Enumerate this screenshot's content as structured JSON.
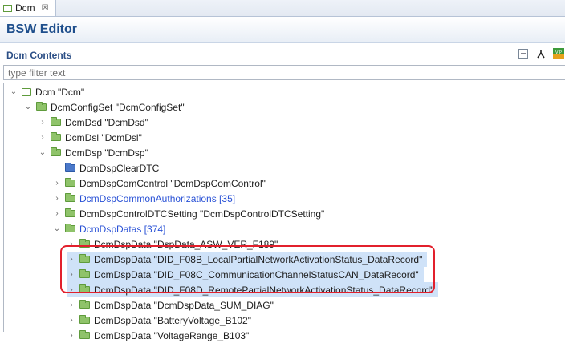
{
  "tab": {
    "label": "Dcm",
    "close": "☒"
  },
  "editor": {
    "title": "BSW Editor"
  },
  "section": {
    "title": "Dcm Contents"
  },
  "filter": {
    "placeholder": "type filter text"
  },
  "tree": [
    {
      "label": "Dcm \"Dcm\"",
      "icon": "module-icon"
    },
    {
      "label": "DcmConfigSet \"DcmConfigSet\"",
      "icon": "folder-icon"
    },
    {
      "label": "DcmDsd \"DcmDsd\"",
      "icon": "folder-icon"
    },
    {
      "label": "DcmDsl \"DcmDsl\"",
      "icon": "folder-icon"
    },
    {
      "label": "DcmDsp \"DcmDsp\"",
      "icon": "folder-icon"
    },
    {
      "label": "DcmDspClearDTC",
      "icon": "folder-blue-icon"
    },
    {
      "label": "DcmDspComControl \"DcmDspComControl\"",
      "icon": "folder-icon"
    },
    {
      "label": "DcmDspCommonAuthorizations [35]",
      "icon": "folder-icon"
    },
    {
      "label": "DcmDspControlDTCSetting \"DcmDspControlDTCSetting\"",
      "icon": "folder-icon"
    },
    {
      "label": "DcmDspDatas [374]",
      "icon": "folder-icon"
    },
    {
      "label": "DcmDspData \"DspData_ASW_VER_F189\"",
      "icon": "folder-icon"
    },
    {
      "label": "DcmDspData \"DID_F08B_LocalPartialNetworkActivationStatus_DataRecord\"",
      "icon": "folder-icon"
    },
    {
      "label": "DcmDspData \"DID_F08C_CommunicationChannelStatusCAN_DataRecord\"",
      "icon": "folder-icon"
    },
    {
      "label": "DcmDspData \"DID_F08D_RemotePartialNetworkActivationStatus_DataRecord\"",
      "icon": "folder-icon"
    },
    {
      "label": "DcmDspData \"DcmDspData_SUM_DIAG\"",
      "icon": "folder-icon"
    },
    {
      "label": "DcmDspData \"BatteryVoltage_B102\"",
      "icon": "folder-icon"
    },
    {
      "label": "DcmDspData \"VoltageRange_B103\"",
      "icon": "folder-icon"
    }
  ]
}
